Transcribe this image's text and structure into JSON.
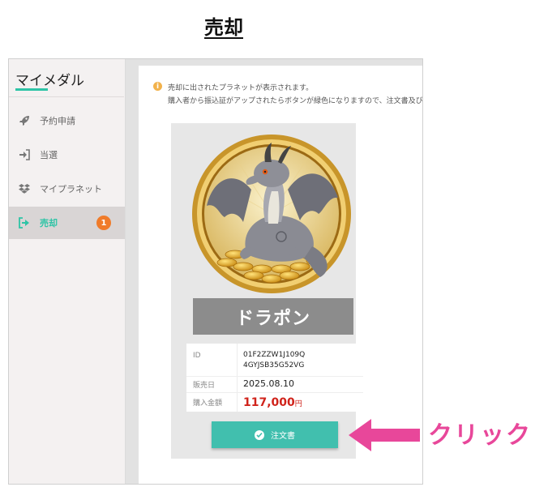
{
  "heading": "売却",
  "sidebar": {
    "title": "マイメダル",
    "items": [
      {
        "label": "予約申請",
        "icon": "rocket-icon"
      },
      {
        "label": "当選",
        "icon": "sign-in-icon"
      },
      {
        "label": "マイプラネット",
        "icon": "dropbox-icon"
      },
      {
        "label": "売却",
        "icon": "sign-out-icon",
        "badge": "1",
        "active": true
      }
    ]
  },
  "notice": {
    "line1": "売却に出されたプラネットが表示されます。",
    "line2": "購入者から振込証がアップされたらボタンが緑色になりますので、注文書及び"
  },
  "card": {
    "name": "ドラポン",
    "id_label": "ID",
    "id_line1": "01F2ZZW1J109Q",
    "id_line2": "4GYJSB35G52VG",
    "date_label": "販売日",
    "date": "2025.08.10",
    "price_label": "購入金額",
    "price": "117,000",
    "currency": "円",
    "button_label": "注文書"
  },
  "annotation": {
    "label": "クリック"
  },
  "colors": {
    "accent": "#2ec4a6",
    "button": "#41bfae",
    "badge": "#f07b2a",
    "price": "#d0231b",
    "annotation": "#e8479a"
  }
}
